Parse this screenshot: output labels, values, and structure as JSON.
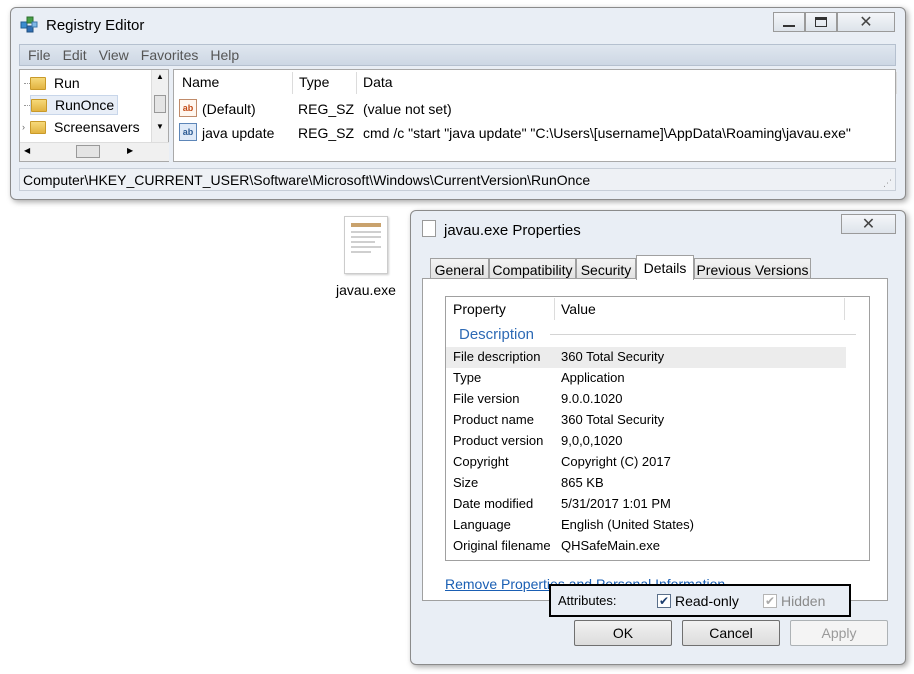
{
  "registry_editor": {
    "title": "Registry Editor",
    "menu": [
      "File",
      "Edit",
      "View",
      "Favorites",
      "Help"
    ],
    "tree": [
      "Run",
      "RunOnce",
      "Screensavers"
    ],
    "columns": [
      "Name",
      "Type",
      "Data"
    ],
    "rows": [
      {
        "name": "(Default)",
        "type": "REG_SZ",
        "data": "(value not set)"
      },
      {
        "name": "java update",
        "type": "REG_SZ",
        "data": "cmd /c \"start \"java update\" \"C:\\Users\\[username]\\AppData\\Roaming\\javau.exe\""
      }
    ],
    "status_path": "Computer\\HKEY_CURRENT_USER\\Software\\Microsoft\\Windows\\CurrentVersion\\RunOnce"
  },
  "desktop_file": {
    "label": "javau.exe"
  },
  "properties": {
    "title": "javau.exe Properties",
    "tabs": [
      "General",
      "Compatibility",
      "Security",
      "Details",
      "Previous Versions"
    ],
    "active_tab": "Details",
    "columns": [
      "Property",
      "Value"
    ],
    "section": "Description",
    "rows": [
      {
        "name": "File description",
        "value": "360 Total Security"
      },
      {
        "name": "Type",
        "value": "Application"
      },
      {
        "name": "File version",
        "value": "9.0.0.1020"
      },
      {
        "name": "Product name",
        "value": "360 Total Security"
      },
      {
        "name": "Product version",
        "value": "9,0,0,1020"
      },
      {
        "name": "Copyright",
        "value": "Copyright (C) 2017"
      },
      {
        "name": "Size",
        "value": "865 KB"
      },
      {
        "name": "Date modified",
        "value": "5/31/2017 1:01 PM"
      },
      {
        "name": "Language",
        "value": "English (United States)"
      },
      {
        "name": "Original filename",
        "value": "QHSafeMain.exe"
      }
    ],
    "remove_link": "Remove Properties and Personal Information",
    "attributes_label": "Attributes:",
    "readonly_label": "Read-only",
    "hidden_label": "Hidden",
    "ok": "OK",
    "cancel": "Cancel",
    "apply": "Apply"
  }
}
